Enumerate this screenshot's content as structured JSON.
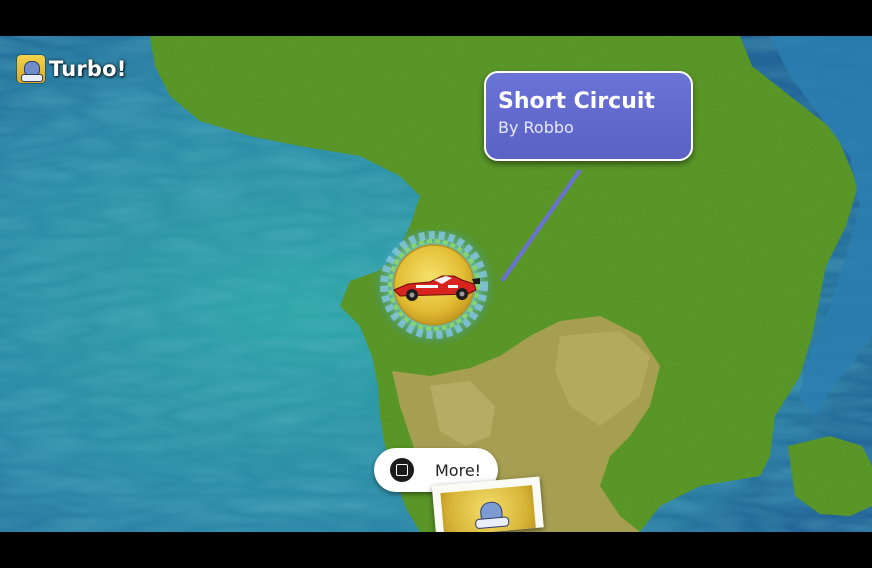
{
  "player": {
    "name": "Turbo!",
    "avatar_icon": "robot-avatar-icon"
  },
  "level": {
    "title": "Short Circuit",
    "author": "By Robbo",
    "marker_icon": "race-car-icon"
  },
  "more_button": {
    "icon": "square-button-icon",
    "label": "More!"
  },
  "colors": {
    "ocean": "#2f8fa8",
    "land": "#4f8a1f",
    "desert": "#a9a052",
    "card": "#5f68cc",
    "marker_gold": "#e8c53a"
  }
}
